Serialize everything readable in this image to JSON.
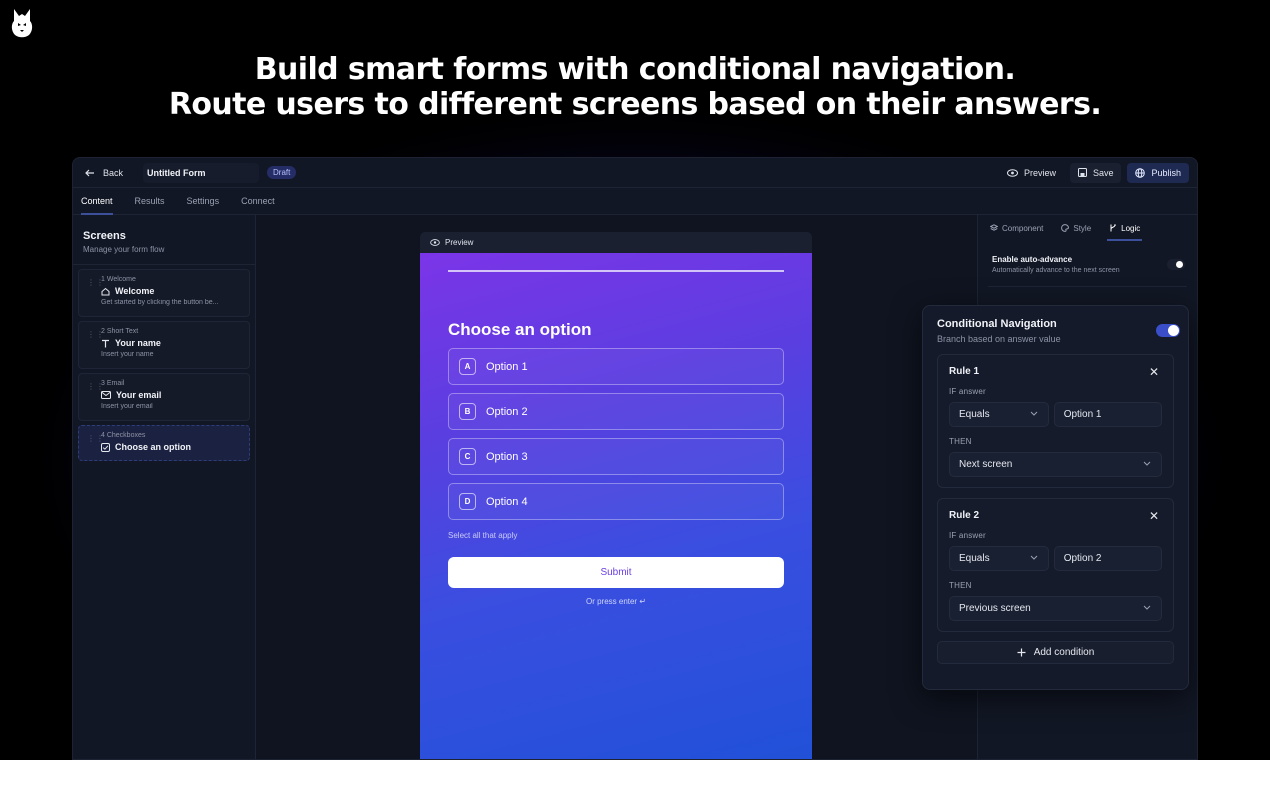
{
  "headline": {
    "line1": "Build smart forms with conditional navigation.",
    "line2": "Route users to different screens based on their answers."
  },
  "topbar": {
    "back_label": "Back",
    "form_title": "Untitled Form",
    "status_badge": "Draft",
    "preview_label": "Preview",
    "save_label": "Save",
    "publish_label": "Publish"
  },
  "tabs": [
    "Content",
    "Results",
    "Settings",
    "Connect"
  ],
  "sidebar": {
    "title": "Screens",
    "subtitle": "Manage your form flow",
    "items": [
      {
        "meta": "1  Welcome",
        "label": "Welcome",
        "desc": "Get started by clicking the button be...",
        "icon": "home-icon"
      },
      {
        "meta": "2  Short Text",
        "label": "Your name",
        "desc": "Insert your name",
        "icon": "text-icon"
      },
      {
        "meta": "3  Email",
        "label": "Your email",
        "desc": "Insert your email",
        "icon": "mail-icon"
      },
      {
        "meta": "4  Checkboxes",
        "label": "Choose an option",
        "desc": "",
        "icon": "checkbox-icon"
      }
    ]
  },
  "preview": {
    "header_label": "Preview",
    "question": "Choose an option",
    "options": [
      {
        "key": "A",
        "label": "Option 1"
      },
      {
        "key": "B",
        "label": "Option 2"
      },
      {
        "key": "C",
        "label": "Option 3"
      },
      {
        "key": "D",
        "label": "Option 4"
      }
    ],
    "hint": "Select all that apply",
    "submit_label": "Submit",
    "press_enter": "Or press enter ↵"
  },
  "right_panel": {
    "tabs": [
      "Component",
      "Style",
      "Logic"
    ],
    "auto_advance_title": "Enable auto-advance",
    "auto_advance_sub": "Automatically advance to the next screen"
  },
  "conditional": {
    "title": "Conditional Navigation",
    "subtitle": "Branch based on answer value",
    "rules": [
      {
        "title": "Rule 1",
        "if_label": "IF answer",
        "operator": "Equals",
        "value": "Option 1",
        "then_label": "THEN",
        "action": "Next screen"
      },
      {
        "title": "Rule 2",
        "if_label": "IF answer",
        "operator": "Equals",
        "value": "Option 2",
        "then_label": "THEN",
        "action": "Previous screen"
      }
    ],
    "add_label": "Add condition"
  },
  "colors": {
    "accent": "#3a4ec9",
    "gradient_top": "#7b35e8",
    "gradient_bottom": "#2151d8"
  }
}
